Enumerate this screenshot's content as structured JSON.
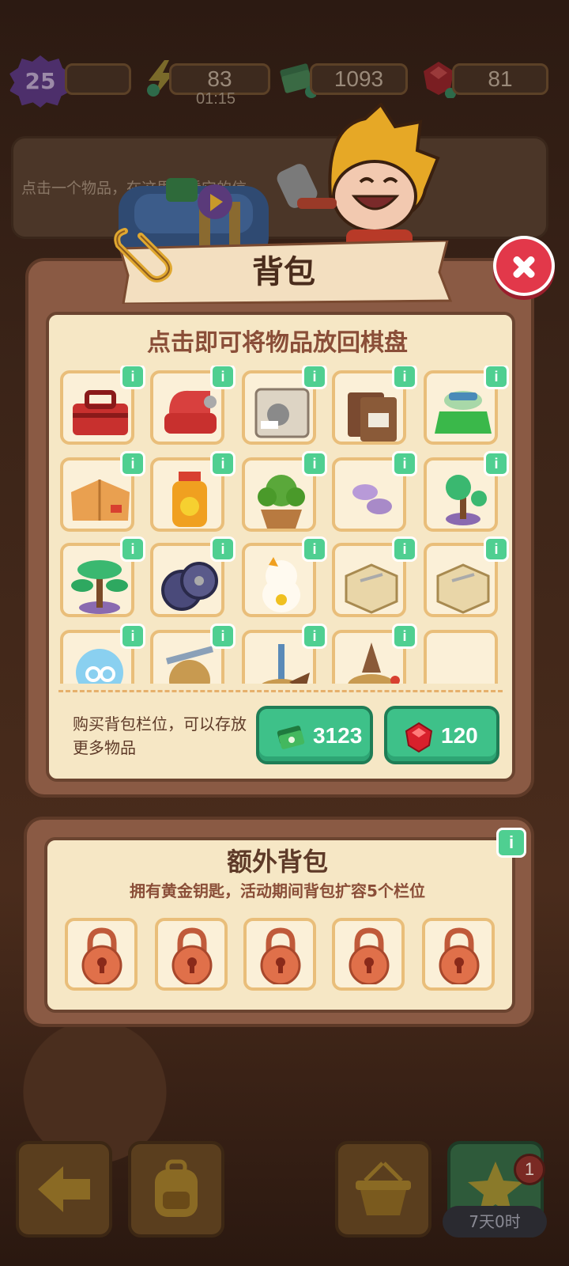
{
  "hud": {
    "level": "25",
    "energy": "83",
    "energy_timer": "01:15",
    "cash": "1093",
    "gems": "81"
  },
  "hint": {
    "text": "点击一个物品，在这里查看它的信"
  },
  "backpack": {
    "title": "背包",
    "subtitle": "点击即可将物品放回棋盘",
    "info_label": "i",
    "items": [
      {
        "icon": "red-toolbox-icon"
      },
      {
        "icon": "red-sewing-machine-icon"
      },
      {
        "icon": "ziplock-bag-icon"
      },
      {
        "icon": "leather-wallet-icon"
      },
      {
        "icon": "green-tutu-icon"
      },
      {
        "icon": "cardboard-parcel-icon"
      },
      {
        "icon": "oil-bottle-icon"
      },
      {
        "icon": "potted-tree-icon"
      },
      {
        "icon": "purple-beans-icon"
      },
      {
        "icon": "small-bonsai-icon"
      },
      {
        "icon": "bonsai-tree-icon"
      },
      {
        "icon": "wheels-icon"
      },
      {
        "icon": "lucky-cat-icon"
      },
      {
        "icon": "cake-box-icon"
      },
      {
        "icon": "cake-box-icon"
      },
      {
        "icon": "blue-scissors-icon"
      },
      {
        "icon": "grindstone-icon"
      },
      {
        "icon": "wooden-stand-icon"
      },
      {
        "icon": "brown-cone-icon"
      },
      {
        "icon": "empty-slot"
      }
    ],
    "buy_text": "购买背包栏位，可以存放更多物品",
    "buy_cash": "3123",
    "buy_gems": "120"
  },
  "extra": {
    "title": "额外背包",
    "desc": "拥有黄金钥匙，活动期间背包扩容5个栏位",
    "slots": [
      {
        "icon": "padlock-icon"
      },
      {
        "icon": "padlock-icon"
      },
      {
        "icon": "padlock-icon"
      },
      {
        "icon": "padlock-icon"
      },
      {
        "icon": "padlock-icon"
      }
    ]
  },
  "nav": {
    "notification_count": "1",
    "event_timer": "7天0时"
  }
}
